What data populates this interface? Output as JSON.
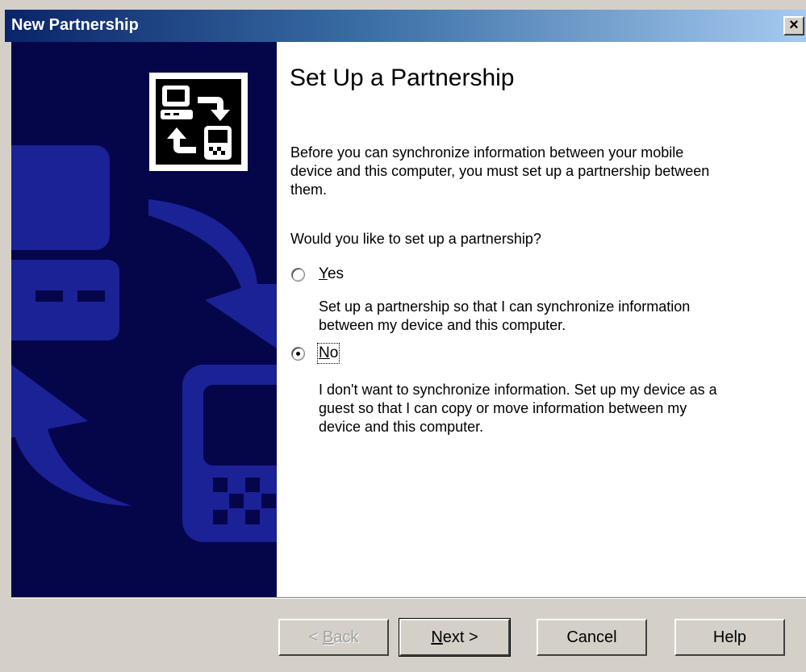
{
  "window": {
    "title": "New Partnership",
    "close_glyph": "×"
  },
  "page": {
    "heading": "Set Up a Partnership",
    "intro": "Before you can synchronize information between your mobile device and this computer, you must set up a partnership between them.",
    "question": "Would you like to set up a partnership?"
  },
  "options": {
    "yes": {
      "mnemonic": "Y",
      "rest": "es",
      "selected": false,
      "description": "Set up a partnership so that I can synchronize information between my device and this computer."
    },
    "no": {
      "mnemonic": "N",
      "rest": "o",
      "selected": true,
      "description": "I don't want to synchronize information. Set up my device as a guest so that I can copy or move information between my device and this computer."
    }
  },
  "buttons": {
    "back": {
      "prefix": "< ",
      "mnemonic": "B",
      "rest": "ack",
      "enabled": false
    },
    "next": {
      "mnemonic": "N",
      "rest": "ext >",
      "enabled": true
    },
    "cancel": {
      "label": "Cancel"
    },
    "help": {
      "label": "Help"
    }
  },
  "colors": {
    "title_start": "#0a246a",
    "title_end": "#a6caf0",
    "panel_bg": "#05054a",
    "panel_shape": "#1a2296",
    "face": "#d4d0c8"
  },
  "icons": {
    "banner": "computer-device-sync-icon"
  }
}
